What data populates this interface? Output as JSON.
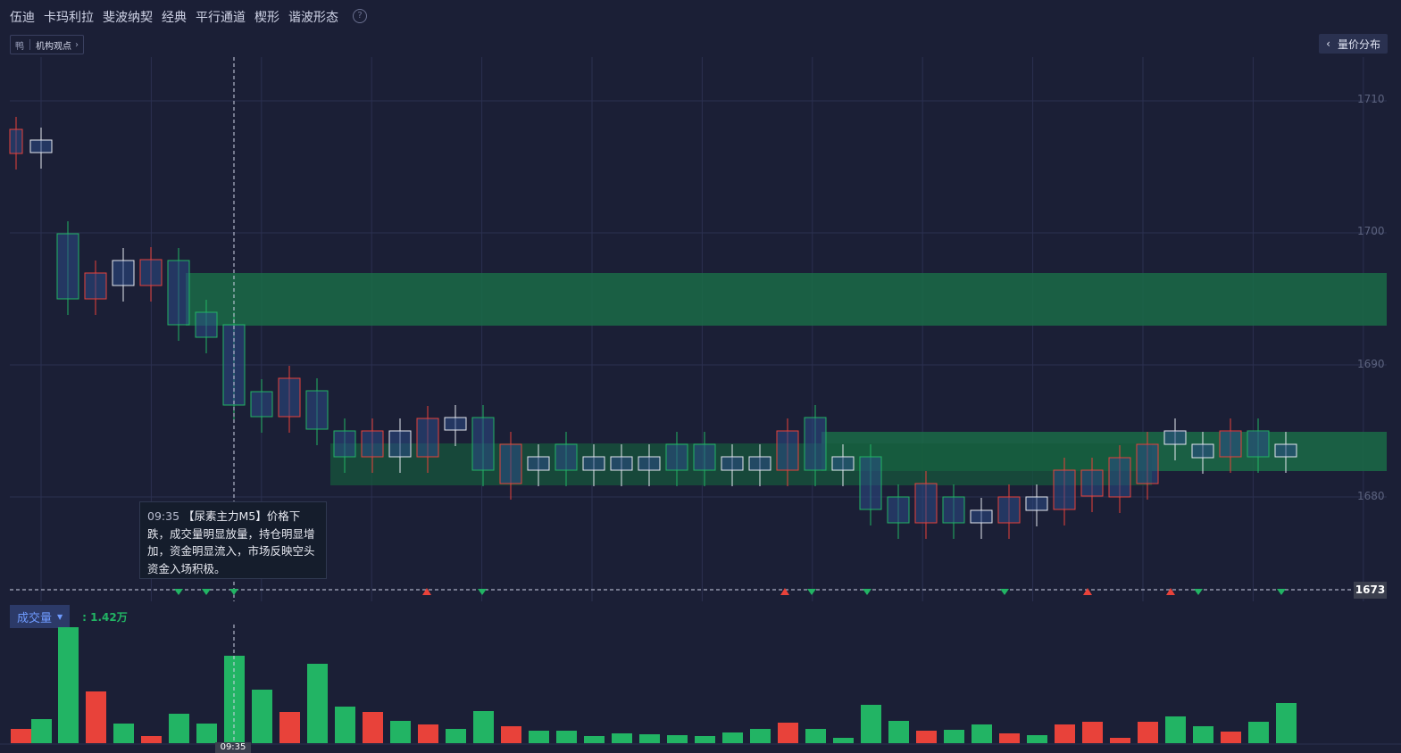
{
  "nav": {
    "items": [
      "伍迪",
      "卡玛利拉",
      "斐波纳契",
      "经典",
      "平行通道",
      "楔形",
      "谐波形态"
    ],
    "help": "?"
  },
  "tag": {
    "icon": "鸭",
    "label": "机构观点"
  },
  "volume_profile_button": "量价分布",
  "price_axis": [
    "1710",
    "1700",
    "1690",
    "1680"
  ],
  "current_price": "1673",
  "tooltip": {
    "time": "09:35",
    "text": "【尿素主力M5】价格下跌，成交量明显放量，持仓明显增加，资金明显流入，市场反映空头资金入场积极。"
  },
  "volume": {
    "label": "成交量",
    "value": ": 1.42万"
  },
  "time_tag": "09:35",
  "colors": {
    "background": "#1b1f36",
    "up": "#22b464",
    "down": "#e8423a",
    "zone": "#1a6b46"
  }
}
